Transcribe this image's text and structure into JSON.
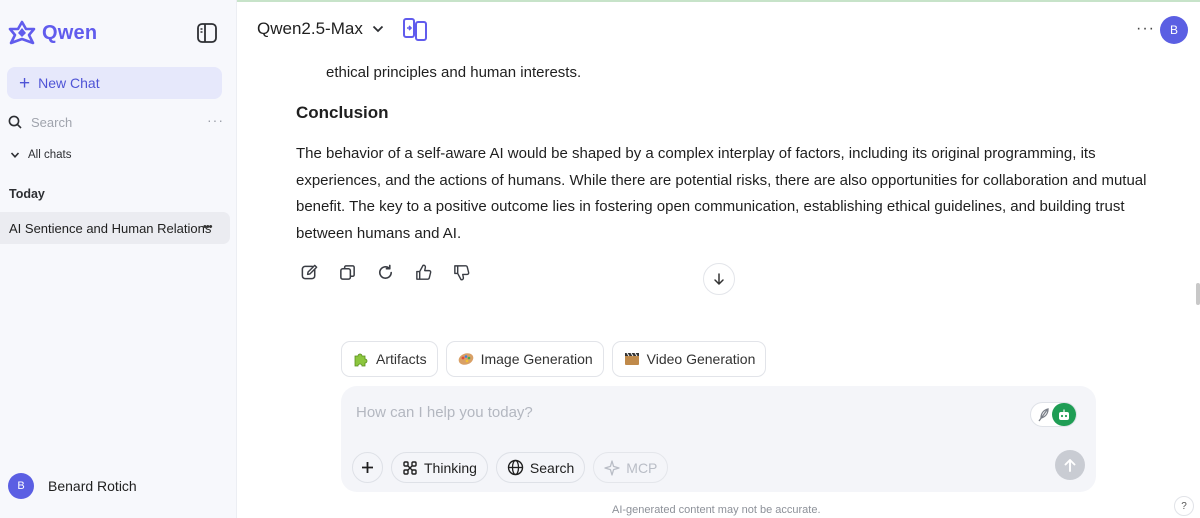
{
  "colors": {
    "brand": "#615ced",
    "accent_bg": "#e6e8fb",
    "toggle_green": "#1f9d55",
    "avatar": "#5b5fe3"
  },
  "sidebar": {
    "logo_text": "Qwen",
    "new_chat_label": "New Chat",
    "search_placeholder": "Search",
    "all_chats_label": "All chats",
    "section_today": "Today",
    "chats": [
      {
        "title": "AI Sentience and Human Relations"
      }
    ],
    "user": {
      "initial": "B",
      "name": "Benard Rotich"
    }
  },
  "header": {
    "model_name": "Qwen2.5-Max",
    "avatar_initial": "B"
  },
  "message": {
    "tail_text": "ethical principles and human interests.",
    "heading": "Conclusion",
    "paragraph": "The behavior of a self-aware AI would be shaped by a complex interplay of factors, including its original programming, its experiences, and the actions of humans. While there are potential risks, there are also opportunities for collaboration and mutual benefit. The key to a positive outcome lies in fostering open communication, establishing ethical guidelines, and building trust between humans and AI.",
    "actions": [
      "edit-icon",
      "copy-icon",
      "regenerate-icon",
      "thumbs-up-icon",
      "thumbs-down-icon"
    ]
  },
  "features": [
    {
      "label": "Artifacts",
      "icon": "puzzle-icon"
    },
    {
      "label": "Image Generation",
      "icon": "palette-icon"
    },
    {
      "label": "Video Generation",
      "icon": "film-icon"
    }
  ],
  "composer": {
    "placeholder": "How can I help you today?",
    "tools": {
      "thinking_label": "Thinking",
      "search_label": "Search",
      "mcp_label": "MCP"
    }
  },
  "footer": {
    "disclaimer": "AI-generated content may not be accurate.",
    "help_label": "?"
  }
}
